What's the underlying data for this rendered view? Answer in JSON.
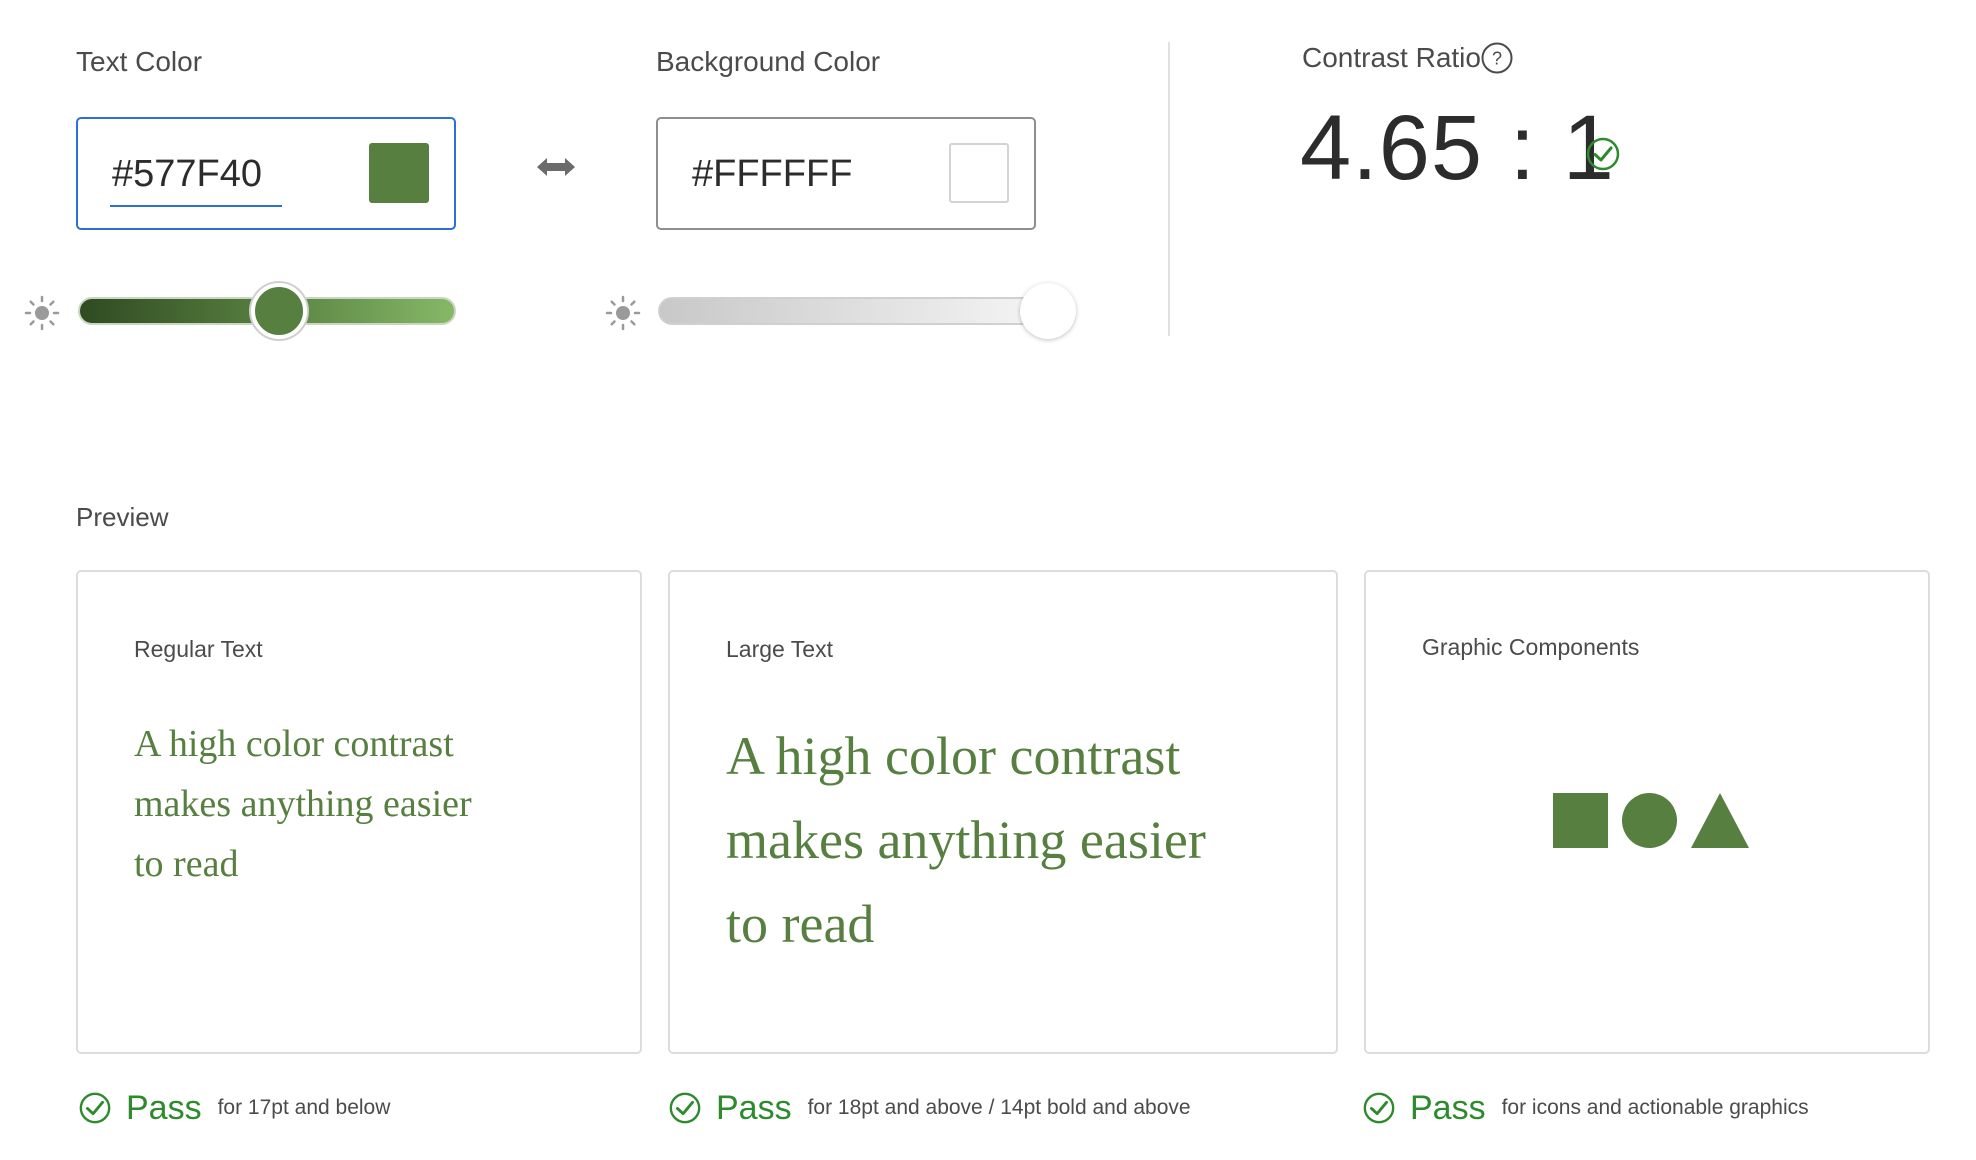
{
  "text_color": {
    "label": "Text Color",
    "value": "#577F40",
    "swatch": "#577F40",
    "brightness": 0.53
  },
  "swap_icon": "swap-arrows-icon",
  "background_color": {
    "label": "Background Color",
    "value": "#FFFFFF",
    "swatch": "#FFFFFF",
    "brightness": 1.0
  },
  "contrast": {
    "label": "Contrast Ratio",
    "help_icon": "help-icon",
    "value": "4.65 : 1",
    "status_icon": "check-circle-icon"
  },
  "preview": {
    "heading": "Preview",
    "regular": {
      "title": "Regular Text",
      "lines": [
        "A high color contrast",
        "makes anything easier",
        "to read"
      ]
    },
    "large": {
      "title": "Large Text",
      "lines": [
        "A high color contrast",
        "makes anything easier",
        "to read"
      ]
    },
    "graphic": {
      "title": "Graphic Components",
      "shapes": [
        "square",
        "circle",
        "triangle"
      ]
    }
  },
  "results": [
    {
      "status": "Pass",
      "desc": "for 17pt and below"
    },
    {
      "status": "Pass",
      "desc": "for 18pt and above / 14pt bold and above"
    },
    {
      "status": "Pass",
      "desc": "for icons and actionable graphics"
    }
  ],
  "colors": {
    "text": "#577F40",
    "pass": "#2D8A2D",
    "focus": "#2D6FD6"
  }
}
